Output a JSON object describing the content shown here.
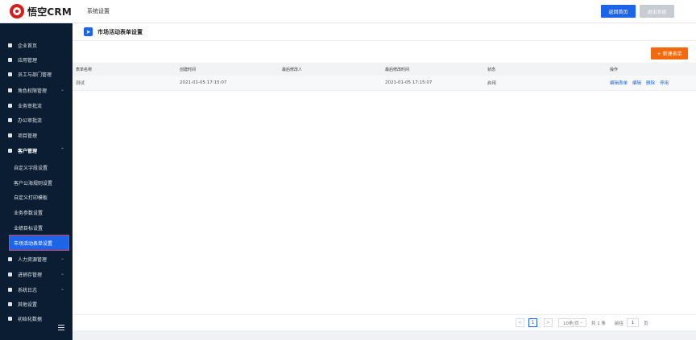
{
  "app": {
    "name": "悟空CRM",
    "logo_icon": "monkey-logo-icon"
  },
  "header": {
    "breadcrumb": "系统设置",
    "back_home_label": "返回首页",
    "exit_system_label": "退出系统"
  },
  "colors": {
    "primary": "#1c64e8",
    "sidebar_bg": "#0b1d33",
    "accent_orange": "#f36a0e",
    "highlight_outline": "#e03e4a",
    "disabled": "#c7cbd2"
  },
  "sidebar": {
    "items": [
      {
        "label": "企业首页",
        "icon": "home-icon"
      },
      {
        "label": "应用管理",
        "icon": "grid-icon"
      },
      {
        "label": "员工与部门管理",
        "icon": "users-icon"
      },
      {
        "label": "角色权限管理",
        "icon": "user-role-icon",
        "expandable": true
      },
      {
        "label": "业务审批流",
        "icon": "approval-icon"
      },
      {
        "label": "办公审批流",
        "icon": "office-approval-icon"
      },
      {
        "label": "项目管理",
        "icon": "list-icon"
      },
      {
        "label": "客户管理",
        "icon": "customer-icon",
        "expandable": true,
        "expanded": true
      }
    ],
    "customer_sub_items": [
      {
        "label": "自定义字段设置"
      },
      {
        "label": "客户公海规则设置"
      },
      {
        "label": "自定义打印模板"
      },
      {
        "label": "业务参数设置"
      },
      {
        "label": "业绩目标设置"
      },
      {
        "label": "市场活动表单设置",
        "active": true
      }
    ],
    "items_after": [
      {
        "label": "人力资源管理",
        "icon": "hr-icon",
        "expandable": true
      },
      {
        "label": "进销存管理",
        "icon": "inventory-icon",
        "expandable": true
      },
      {
        "label": "系统日志",
        "icon": "log-icon",
        "expandable": true
      },
      {
        "label": "其他设置",
        "icon": "gear-icon"
      },
      {
        "label": "初始化数据",
        "icon": "chart-icon"
      }
    ]
  },
  "main": {
    "page_title": "市场活动表单设置",
    "new_button_label": "+ 新建表单",
    "table": {
      "columns": [
        "表单名称",
        "创建时间",
        "最后修改人",
        "最后修改时间",
        "状态",
        "操作"
      ],
      "rows": [
        {
          "name": "测试",
          "created": "2021-01-05 17:15:07",
          "modifier": "",
          "modified": "2021-01-05 17:15:07",
          "status": "启用",
          "actions": [
            "编辑表单",
            "编辑",
            "删除",
            "停用"
          ]
        }
      ]
    },
    "pagination": {
      "prev": "<",
      "current_page": "1",
      "next": ">",
      "page_size": "10条/页",
      "total": "共 1 条",
      "goto_label": "前往",
      "goto_value": "1",
      "page_unit": "页"
    }
  }
}
